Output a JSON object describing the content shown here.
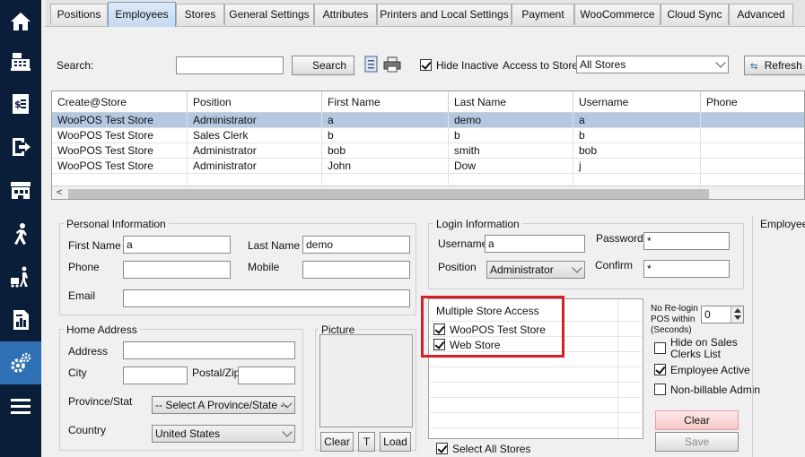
{
  "tabs": [
    {
      "label": "Positions"
    },
    {
      "label": "Employees",
      "selected": true
    },
    {
      "label": "Stores"
    },
    {
      "label": "General Settings"
    },
    {
      "label": "Attributes"
    },
    {
      "label": "Printers and Local Settings"
    },
    {
      "label": "Payment"
    },
    {
      "label": "WooCommerce"
    },
    {
      "label": "Cloud Sync"
    },
    {
      "label": "Advanced"
    }
  ],
  "nav_icons": [
    "home-icon",
    "cash-register-icon",
    "receipt-icon",
    "logout-icon",
    "store-icon",
    "walking-person-icon",
    "delivery-person-icon",
    "report-icon",
    "settings-gears-icon",
    "menu-icon"
  ],
  "toolbar": {
    "search_label": "Search:",
    "search_value": "",
    "search_button": "Search",
    "hide_inactive_label": "Hide Inactive",
    "hide_inactive_checked": true,
    "access_to_store_label": "Access to Store:",
    "access_to_store_value": "All Stores",
    "refresh_button": "Refresh"
  },
  "grid": {
    "columns": [
      "Create@Store",
      "Position",
      "First Name",
      "Last Name",
      "Username",
      "Phone"
    ],
    "rows": [
      [
        "WooPOS Test Store",
        "Administrator",
        "a",
        "demo",
        "a",
        ""
      ],
      [
        "WooPOS Test Store",
        "Sales Clerk",
        "b",
        "b",
        "b",
        ""
      ],
      [
        "WooPOS Test Store",
        "Administrator",
        "bob",
        "smith",
        "bob",
        ""
      ],
      [
        "WooPOS Test Store",
        "Administrator",
        "John",
        "Dow",
        "j",
        ""
      ]
    ],
    "selected_row": 0
  },
  "personal": {
    "title": "Personal Information",
    "first_name_label": "First Name",
    "first_name": "a",
    "last_name_label": "Last Name",
    "last_name": "demo",
    "phone_label": "Phone",
    "phone": "",
    "mobile_label": "Mobile",
    "mobile": "",
    "email_label": "Email",
    "email": ""
  },
  "address": {
    "title": "Home Address",
    "address_label": "Address",
    "address": "",
    "city_label": "City",
    "city": "",
    "postal_label": "Postal/Zip",
    "postal": "",
    "province_label": "Province/Stat",
    "province": "-- Select A Province/State --",
    "country_label": "Country",
    "country": "United States"
  },
  "picture": {
    "title": "Picture",
    "clear": "Clear",
    "t": "T",
    "load": "Load"
  },
  "login": {
    "title": "Login Information",
    "username_label": "Username",
    "username": "a",
    "password_label": "Password",
    "password": "*",
    "position_label": "Position",
    "position": "Administrator",
    "confirm_label": "Confirm",
    "confirm": "*"
  },
  "store_access": {
    "title": "Multiple Store Access",
    "stores": [
      {
        "name": "WooPOS Test Store",
        "checked": true
      },
      {
        "name": "Web Store",
        "checked": true
      }
    ],
    "select_all_label": "Select All Stores",
    "select_all_checked": true
  },
  "options": {
    "relogin_label_1": "No Re-login",
    "relogin_label_2": "POS within",
    "relogin_label_3": "(Seconds)",
    "relogin_value": "0",
    "hide_sales_clerks_1": "Hide on Sales",
    "hide_sales_clerks_2": "Clerks List",
    "hide_sales_clerks_checked": false,
    "employee_active": "Employee Active",
    "employee_active_checked": true,
    "non_billable": "Non-billable Admin",
    "non_billable_checked": false,
    "clear_button": "Clear",
    "save_button": "Save"
  },
  "employee_panel_title": "Employee A",
  "colors": {
    "rail": "#0a1e3a",
    "rail_active": "#2f6fb3",
    "selected_row": "#b4c8e4",
    "highlight": "#d4202a"
  }
}
